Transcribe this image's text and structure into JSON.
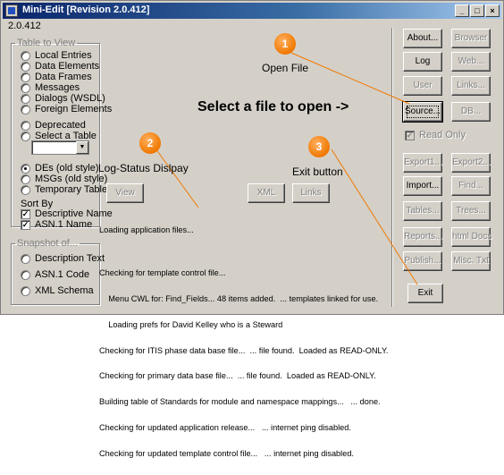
{
  "window": {
    "title": "Mini-Edit   [Revision 2.0.412]",
    "version": "2.0.412",
    "minimize": "_",
    "maximize": "□",
    "close": "×"
  },
  "table_to_view": {
    "legend": "Table to View",
    "options": [
      "Local Entries",
      "Data Elements",
      "Data Frames",
      "Messages",
      "Dialogs (WSDL)",
      "Foreign Elements",
      "Deprecated",
      "Select a Table"
    ],
    "formats": [
      "DEs    (old style)",
      "MSGs (old style)",
      "Temporary Table"
    ],
    "selected_format": "DEs    (old style)",
    "sort_by_label": "Sort By",
    "sort_options": [
      {
        "label": "Descriptive Name",
        "checked": true
      },
      {
        "label": "ASN.1 Name",
        "checked": true
      }
    ]
  },
  "snapshot": {
    "legend": "Snapshot of...",
    "options": [
      "Description Text",
      "ASN.1 Code",
      "XML Schema"
    ]
  },
  "center_buttons": {
    "view": "View",
    "xml": "XML",
    "links": "Links"
  },
  "log": {
    "lines": [
      "Loading application files...",
      "",
      "Checking for template control file...",
      "    Menu CWL for: Find_Fields... 48 items added.  ... templates linked for use.",
      "    Loading prefs for David Kelley who is a Steward",
      "Checking for ITIS phase data base file...  ... file found.  Loaded as READ-ONLY.",
      "Checking for primary data base file...  ... file found.  Loaded as READ-ONLY.",
      "Building table of Standards for module and namespace mappings...   ... done.",
      "Checking for updated application release...   ... internet ping disabled.",
      "Checking for updated template control file...   ... internet ping disabled."
    ]
  },
  "right_buttons": {
    "about": "About...",
    "browser": "Browser",
    "log": "Log",
    "web": "Web...",
    "user": "User",
    "links": "Links...",
    "source": "Source...",
    "db": "DB...",
    "read_only": "Read Only",
    "read_only_checked": true,
    "export1": "Export1...",
    "export2": "Export2...",
    "import": "Import...",
    "find": "Find...",
    "tables": "Tables...",
    "trees": "Trees...",
    "reports": "Reports...",
    "html_docs": "html Docs",
    "publish": "Publish...",
    "misc_txt": "Misc. Txt",
    "exit": "Exit"
  },
  "annotations": {
    "callout1_num": "1",
    "callout1_label": "Open File",
    "callout2_num": "2",
    "callout2_label": "Log-Status Dislpay",
    "callout3_num": "3",
    "callout3_label": "Exit button",
    "select_file_text": "Select a file to open    ->",
    "accent_color": "#f07800"
  }
}
